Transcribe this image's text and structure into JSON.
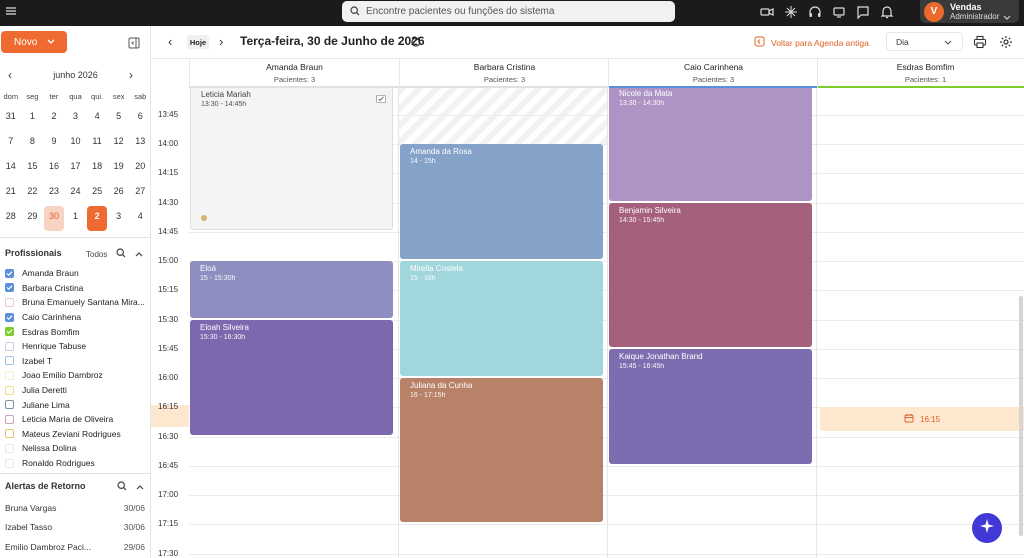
{
  "topbar": {
    "search_placeholder": "Encontre pacientes ou funções do sistema",
    "user": {
      "initial": "V",
      "name": "Vendas",
      "role": "Administrador"
    },
    "icons": [
      "video-icon",
      "sparkle-icon",
      "headset-icon",
      "tv-icon",
      "chat-icon",
      "bell-icon"
    ]
  },
  "sidebar": {
    "new_button": "Novo",
    "calendar": {
      "month_label": "junho 2026",
      "weekdays": [
        "dom",
        "seg",
        "ter",
        "qua",
        "qui.",
        "sex",
        "sab"
      ],
      "weeks": [
        [
          "31",
          "1",
          "2",
          "3",
          "4",
          "5",
          "6"
        ],
        [
          "7",
          "8",
          "9",
          "10",
          "11",
          "12",
          "13"
        ],
        [
          "14",
          "15",
          "16",
          "17",
          "18",
          "19",
          "20"
        ],
        [
          "21",
          "22",
          "23",
          "24",
          "25",
          "26",
          "27"
        ],
        [
          "28",
          "29",
          "30",
          "1",
          "2",
          "3",
          "4"
        ]
      ],
      "today": "30",
      "selected": "2"
    },
    "professionals": {
      "title": "Profissionais",
      "all_label": "Todos",
      "items": [
        {
          "name": "Amanda Braun",
          "checked": true,
          "color": "#5b8fd9"
        },
        {
          "name": "Barbara Cristina",
          "checked": true,
          "color": "#5b8fd9"
        },
        {
          "name": "Bruna Emanuely Santana Mira...",
          "checked": false,
          "color": "#f2c1d4"
        },
        {
          "name": "Caio Carinhena",
          "checked": true,
          "color": "#5b8fd9"
        },
        {
          "name": "Esdras Bomfim",
          "checked": true,
          "color": "#7ecb2c"
        },
        {
          "name": "Henrique Tabuse",
          "checked": false,
          "color": "#d9c6e6"
        },
        {
          "name": "Izabel T",
          "checked": false,
          "color": "#9cc3e8"
        },
        {
          "name": "Joao Emilio Dambroz",
          "checked": false,
          "color": "#f5f0c8"
        },
        {
          "name": "Julia Deretti",
          "checked": false,
          "color": "#f2dc8c"
        },
        {
          "name": "Juliane Lima",
          "checked": false,
          "color": "#7d8fa8"
        },
        {
          "name": "Leticia Maria de Oliveira",
          "checked": false,
          "color": "#c9a0b8"
        },
        {
          "name": "Mateus Zeviani Rodrigues",
          "checked": false,
          "color": "#f0c46a"
        },
        {
          "name": "Nelissa Dolina",
          "checked": false,
          "color": "#e8e8e8"
        },
        {
          "name": "Ronaldo Rodrigues",
          "checked": false,
          "color": "#e8e8e8"
        }
      ]
    },
    "alerts": {
      "title": "Alertas de Retorno",
      "items": [
        {
          "name": "Bruna Vargas",
          "date": "30/06"
        },
        {
          "name": "Izabel Tasso",
          "date": "30/06"
        },
        {
          "name": "Emilio Dambroz Paci...",
          "date": "29/06"
        }
      ]
    }
  },
  "header": {
    "today_button": "Hoje",
    "date_title": "Terça-feira, 30 de Junho de 2026",
    "old_agenda_link": "Voltar para Agenda antiga",
    "view_select": "Dia"
  },
  "columns": [
    {
      "name": "Amanda Braun",
      "patients": "Pacientes: 3",
      "color": "#e0e0e0"
    },
    {
      "name": "Barbara Cristina",
      "patients": "Pacientes: 3",
      "color": "#e0e0e0"
    },
    {
      "name": "Caio Carinhena",
      "patients": "Pacientes: 3",
      "color": "#5b8fd9"
    },
    {
      "name": "Esdras Bomfim",
      "patients": "Pacientes: 1",
      "color": "#7ecb2c"
    }
  ],
  "times": [
    "13:45",
    "14:00",
    "14:15",
    "14:30",
    "14:45",
    "15:00",
    "15:15",
    "15:30",
    "15:45",
    "16:00",
    "16:15",
    "16:30",
    "16:45",
    "17:00",
    "17:15",
    "17:30"
  ],
  "partial_time": "14:45",
  "appointments": [
    {
      "col": 0,
      "name": "Leticia Mariah",
      "time": "13:30 - 14:45h",
      "start": "13:30",
      "end": "14:45",
      "color": "#f4f4f4",
      "text": "#444",
      "border": "#ddd"
    },
    {
      "col": 0,
      "name": "Eloá",
      "time": "15 - 15:30h",
      "start": "15:00",
      "end": "15:30",
      "color": "#8e8fc0",
      "text": "#fff",
      "border": ""
    },
    {
      "col": 0,
      "name": "Eloah Silveira",
      "time": "15:30 - 16:30h",
      "start": "15:30",
      "end": "16:30",
      "color": "#7c68ae",
      "text": "#fff",
      "border": ""
    },
    {
      "col": 1,
      "name": "Amanda da Rosa",
      "time": "14 - 15h",
      "start": "14:00",
      "end": "15:00",
      "color": "#85a2c9",
      "text": "#fff",
      "border": ""
    },
    {
      "col": 1,
      "name": "Mirella Costela",
      "time": "15 - 16h",
      "start": "15:00",
      "end": "16:00",
      "color": "#a2d6dd",
      "text": "#fff",
      "border": ""
    },
    {
      "col": 1,
      "name": "Juliana da Cunha",
      "time": "16 - 17:15h",
      "start": "16:00",
      "end": "17:15",
      "color": "#b88269",
      "text": "#fff",
      "border": ""
    },
    {
      "col": 2,
      "name": "Nicole da Mata",
      "time": "13:30 - 14:30h",
      "start": "13:30",
      "end": "14:30",
      "color": "#ae94c4",
      "text": "#fff",
      "border": ""
    },
    {
      "col": 2,
      "name": "Benjamin Silveira",
      "time": "14:30 - 15:45h",
      "start": "14:30",
      "end": "15:45",
      "color": "#a5607e",
      "text": "#fff",
      "border": ""
    },
    {
      "col": 2,
      "name": "Kaique Jonathan Brand",
      "time": "15:45 - 16:45h",
      "start": "15:45",
      "end": "16:45",
      "color": "#7d6caf",
      "text": "#fff",
      "border": ""
    }
  ],
  "free_slot": {
    "col": 3,
    "label": "16:15",
    "start": "16:15"
  },
  "colors": {
    "accent": "#ee6a30",
    "fab": "#4238d6"
  }
}
